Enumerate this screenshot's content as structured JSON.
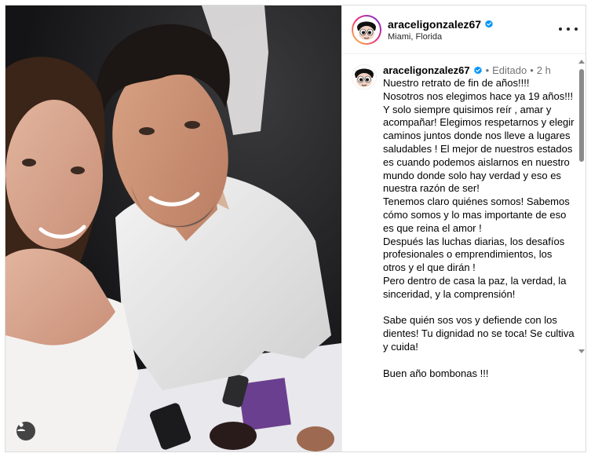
{
  "post": {
    "username": "araceligonzalez67",
    "location": "Miami, Florida",
    "edited_label": "Editado",
    "time_ago": "2 h",
    "caption": "Nuestro retrato de fin de años!!!!\nNosotros nos elegimos hace ya 19 años!!! Y solo siempre quisimos reír , amar y acompañar! Elegimos respetarnos y elegir caminos juntos donde nos lleve a lugares saludables ! El mejor de nuestros estados es cuando podemos aislarnos en nuestro mundo donde solo hay verdad y eso es nuestra razón de ser!\nTenemos claro quiénes somos! Sabemos cómo somos y lo mas importante de eso es que reina el amor !\nDespués las luchas diarias, los desafíos profesionales o emprendimientos, los otros y el que dirán !\nPero dentro de casa la paz, la verdad, la sinceridad, y la comprensión!\n\nSabe quién sos vos y defiende con los dientes! Tu dignidad no se toca! Se cultiva y cuida!\n\nBuen año bombonas !!!"
  },
  "icons": {
    "verified": "verified-badge-icon",
    "more": "more-options-icon",
    "tagged_user": "tagged-user-icon"
  },
  "colors": {
    "verified_blue": "#0095f6",
    "secondary_text": "#737373",
    "border": "#dbdbdb"
  }
}
